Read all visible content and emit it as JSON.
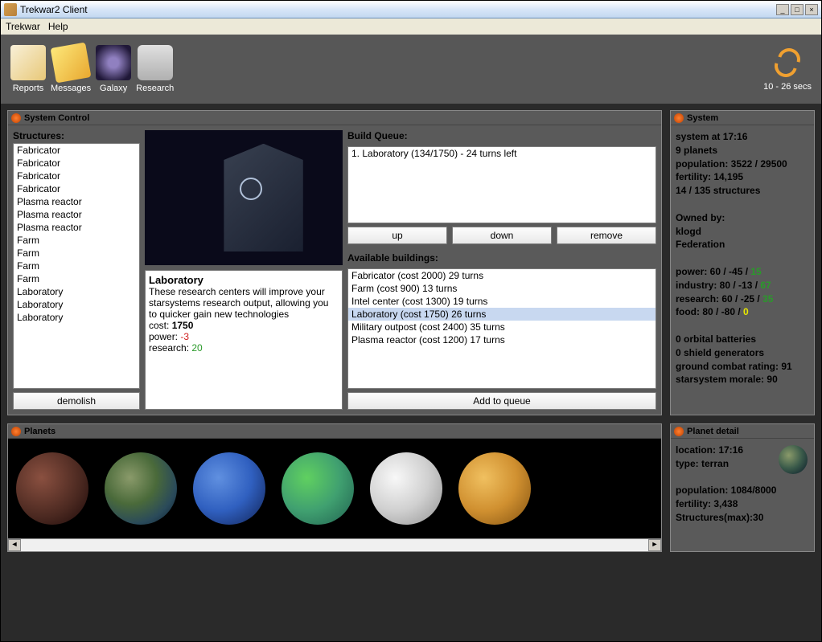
{
  "window": {
    "title": "Trekwar2 Client"
  },
  "menubar": {
    "app": "Trekwar",
    "help": "Help"
  },
  "toolbar": {
    "reports": "Reports",
    "messages": "Messages",
    "galaxy": "Galaxy",
    "research": "Research",
    "timer": "10 - 26 secs"
  },
  "systemControl": {
    "title": "System Control",
    "structuresLabel": "Structures:",
    "structures": [
      "Fabricator",
      "Fabricator",
      "Fabricator",
      "Fabricator",
      "Plasma reactor",
      "Plasma reactor",
      "Plasma reactor",
      "Farm",
      "Farm",
      "Farm",
      "Farm",
      "Laboratory",
      "Laboratory",
      "Laboratory"
    ],
    "demolish": "demolish",
    "desc": {
      "name": "Laboratory",
      "text": "These research centers will improve your starsystems research output, allowing you to quicker gain new technologies",
      "costLabel": "cost:",
      "cost": "1750",
      "powerLabel": "power:",
      "power": "-3",
      "researchLabel": "research:",
      "research": "20"
    },
    "queueLabel": "Build Queue:",
    "queue": [
      "1. Laboratory (134/1750) - 24 turns left"
    ],
    "up": "up",
    "down": "down",
    "remove": "remove",
    "availableLabel": "Available buildings:",
    "available": [
      "Fabricator (cost 2000) 29 turns",
      "Farm (cost 900) 13 turns",
      "Intel center (cost 1300) 19 turns",
      "Laboratory (cost 1750) 26 turns",
      "Military outpost (cost 2400) 35 turns",
      "Plasma reactor (cost 1200) 17 turns"
    ],
    "selectedAvailable": 3,
    "addToQueue": "Add to queue"
  },
  "systemPanel": {
    "title": "System",
    "location": "system at 17:16",
    "planets": "9 planets",
    "population": "population: 3522 / 29500",
    "fertility": "fertility: 14,195",
    "structures": "14 / 135 structures",
    "ownedBy": "Owned by:",
    "owner": "klogd",
    "faction": "Federation",
    "power": {
      "label": "power: 60 / -45 / ",
      "net": "15"
    },
    "industry": {
      "label": "industry: 80 / -13 / ",
      "net": "67"
    },
    "research": {
      "label": "research: 60 / -25 / ",
      "net": "35"
    },
    "food": {
      "label": "food: 80 / -80 / ",
      "net": "0"
    },
    "orbital": "0 orbital batteries",
    "shield": "0 shield generators",
    "combat": "ground combat rating: 91",
    "morale": "starsystem morale: 90"
  },
  "planetsPanel": {
    "title": "Planets"
  },
  "planetDetail": {
    "title": "Planet detail",
    "location": "location: 17:16",
    "type": "type: terran",
    "population": "population: 1084/8000",
    "fertility": "fertility: 3,438",
    "structures": "Structures(max):30"
  }
}
